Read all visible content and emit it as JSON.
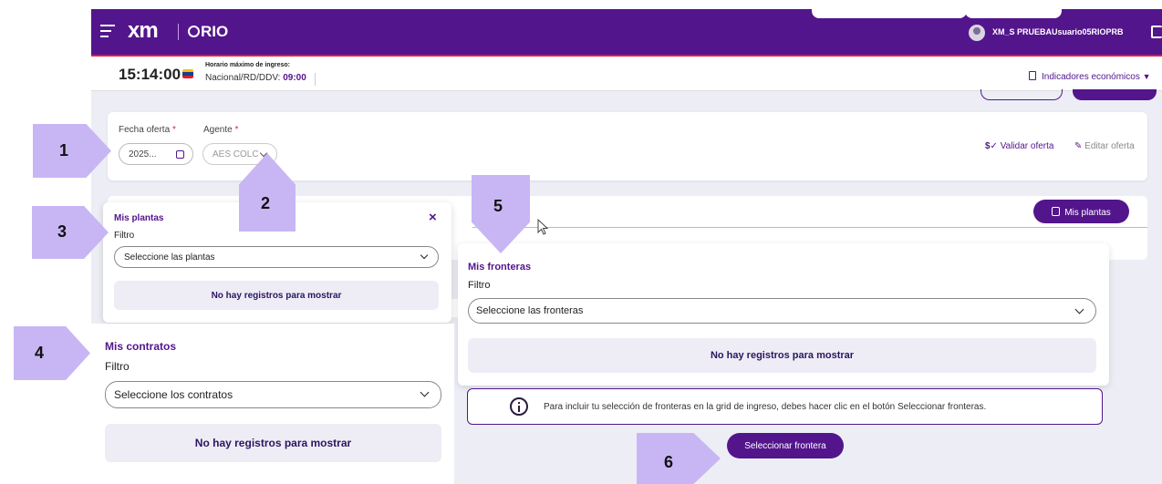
{
  "header": {
    "logo_xm": "xm",
    "logo_app": "RIO",
    "user_name": "XM_S PRUEBAUsuario05RIOPRB"
  },
  "infobar": {
    "time": "15:14:00",
    "horario_label": "Horario máximo de ingreso:",
    "horario_prefix": "Nacional/RD/DDV:",
    "horario_time": "09:00",
    "indicadores": "Indicadores económicos"
  },
  "filters": {
    "fecha_label": "Fecha oferta",
    "fecha_value": "2025...",
    "agente_label": "Agente",
    "agente_value": "AES COLC",
    "required_mark": "*",
    "validar": "Validar oferta",
    "editar": "Editar oferta"
  },
  "mis_plantas_button": "Mis plantas",
  "panels": {
    "plantas": {
      "title": "Mis plantas",
      "filter_label": "Filtro",
      "placeholder": "Seleccione las plantas",
      "empty": "No hay registros para mostrar",
      "close": "×"
    },
    "fronteras": {
      "title": "Mis fronteras",
      "filter_label": "Filtro",
      "placeholder": "Seleccione las fronteras",
      "empty": "No hay registros para mostrar"
    },
    "contratos": {
      "title": "Mis contratos",
      "filter_label": "Filtro",
      "placeholder": "Seleccione los contratos",
      "empty": "No hay registros para mostrar"
    }
  },
  "info_message": "Para incluir tu selección de fronteras en la grid de ingreso, debes hacer clic en el botón Seleccionar fronteras.",
  "select_frontera_button": "Seleccionar frontera",
  "callouts": {
    "c1": "1",
    "c2": "2",
    "c3": "3",
    "c4": "4",
    "c5": "5",
    "c6": "6"
  },
  "colors": {
    "brand": "#53158c",
    "accent_line": "#e0203a",
    "callout": "#c8b6f4"
  }
}
